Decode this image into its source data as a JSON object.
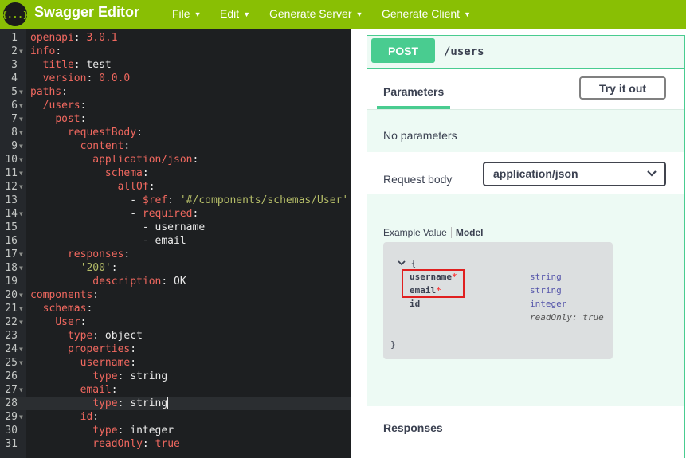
{
  "app": {
    "logo_glyph": "{...}",
    "title": "Swagger Editor",
    "brand_color": "#89bf04"
  },
  "menu": [
    {
      "label": "File"
    },
    {
      "label": "Edit"
    },
    {
      "label": "Generate Server"
    },
    {
      "label": "Generate Client"
    }
  ],
  "editor": {
    "active_line": 28,
    "lines": [
      {
        "n": "1",
        "tokens": [
          {
            "t": "openapi",
            "c": "key"
          },
          {
            "t": ": ",
            "c": "punc"
          },
          {
            "t": "3.0.1",
            "c": "num"
          }
        ]
      },
      {
        "n": "2",
        "fold": true,
        "tokens": [
          {
            "t": "info",
            "c": "key"
          },
          {
            "t": ":",
            "c": "punc"
          }
        ]
      },
      {
        "n": "3",
        "tokens": [
          {
            "t": "  ",
            "c": "txt"
          },
          {
            "t": "title",
            "c": "key"
          },
          {
            "t": ": test",
            "c": "txt"
          }
        ]
      },
      {
        "n": "4",
        "tokens": [
          {
            "t": "  ",
            "c": "txt"
          },
          {
            "t": "version",
            "c": "key"
          },
          {
            "t": ": ",
            "c": "punc"
          },
          {
            "t": "0.0.0",
            "c": "num"
          }
        ]
      },
      {
        "n": "5",
        "fold": true,
        "tokens": [
          {
            "t": "paths",
            "c": "key"
          },
          {
            "t": ":",
            "c": "punc"
          }
        ]
      },
      {
        "n": "6",
        "fold": true,
        "tokens": [
          {
            "t": "  ",
            "c": "txt"
          },
          {
            "t": "/users",
            "c": "key"
          },
          {
            "t": ":",
            "c": "punc"
          }
        ]
      },
      {
        "n": "7",
        "fold": true,
        "tokens": [
          {
            "t": "    ",
            "c": "txt"
          },
          {
            "t": "post",
            "c": "key"
          },
          {
            "t": ":",
            "c": "punc"
          }
        ]
      },
      {
        "n": "8",
        "fold": true,
        "tokens": [
          {
            "t": "      ",
            "c": "txt"
          },
          {
            "t": "requestBody",
            "c": "key"
          },
          {
            "t": ":",
            "c": "punc"
          }
        ]
      },
      {
        "n": "9",
        "fold": true,
        "tokens": [
          {
            "t": "        ",
            "c": "txt"
          },
          {
            "t": "content",
            "c": "key"
          },
          {
            "t": ":",
            "c": "punc"
          }
        ]
      },
      {
        "n": "10",
        "fold": true,
        "tokens": [
          {
            "t": "          ",
            "c": "txt"
          },
          {
            "t": "application/json",
            "c": "key"
          },
          {
            "t": ":",
            "c": "punc"
          }
        ]
      },
      {
        "n": "11",
        "fold": true,
        "tokens": [
          {
            "t": "            ",
            "c": "txt"
          },
          {
            "t": "schema",
            "c": "key"
          },
          {
            "t": ":",
            "c": "punc"
          }
        ]
      },
      {
        "n": "12",
        "fold": true,
        "tokens": [
          {
            "t": "              ",
            "c": "txt"
          },
          {
            "t": "allOf",
            "c": "key"
          },
          {
            "t": ":",
            "c": "punc"
          }
        ]
      },
      {
        "n": "13",
        "tokens": [
          {
            "t": "                - ",
            "c": "txt"
          },
          {
            "t": "$ref",
            "c": "key"
          },
          {
            "t": ": ",
            "c": "punc"
          },
          {
            "t": "'#/components/schemas/User'",
            "c": "str"
          }
        ]
      },
      {
        "n": "14",
        "fold": true,
        "tokens": [
          {
            "t": "                - ",
            "c": "txt"
          },
          {
            "t": "required",
            "c": "key"
          },
          {
            "t": ":",
            "c": "punc"
          }
        ]
      },
      {
        "n": "15",
        "tokens": [
          {
            "t": "                  - username",
            "c": "txt"
          }
        ]
      },
      {
        "n": "16",
        "tokens": [
          {
            "t": "                  - email",
            "c": "txt"
          }
        ]
      },
      {
        "n": "17",
        "fold": true,
        "tokens": [
          {
            "t": "      ",
            "c": "txt"
          },
          {
            "t": "responses",
            "c": "key"
          },
          {
            "t": ":",
            "c": "punc"
          }
        ]
      },
      {
        "n": "18",
        "fold": true,
        "tokens": [
          {
            "t": "        ",
            "c": "txt"
          },
          {
            "t": "'200'",
            "c": "str"
          },
          {
            "t": ":",
            "c": "punc"
          }
        ]
      },
      {
        "n": "19",
        "tokens": [
          {
            "t": "          ",
            "c": "txt"
          },
          {
            "t": "description",
            "c": "key"
          },
          {
            "t": ": OK",
            "c": "txt"
          }
        ]
      },
      {
        "n": "20",
        "fold": true,
        "tokens": [
          {
            "t": "components",
            "c": "key"
          },
          {
            "t": ":",
            "c": "punc"
          }
        ]
      },
      {
        "n": "21",
        "fold": true,
        "tokens": [
          {
            "t": "  ",
            "c": "txt"
          },
          {
            "t": "schemas",
            "c": "key"
          },
          {
            "t": ":",
            "c": "punc"
          }
        ]
      },
      {
        "n": "22",
        "fold": true,
        "tokens": [
          {
            "t": "    ",
            "c": "txt"
          },
          {
            "t": "User",
            "c": "key"
          },
          {
            "t": ":",
            "c": "punc"
          }
        ]
      },
      {
        "n": "23",
        "tokens": [
          {
            "t": "      ",
            "c": "txt"
          },
          {
            "t": "type",
            "c": "key"
          },
          {
            "t": ": object",
            "c": "txt"
          }
        ]
      },
      {
        "n": "24",
        "fold": true,
        "tokens": [
          {
            "t": "      ",
            "c": "txt"
          },
          {
            "t": "properties",
            "c": "key"
          },
          {
            "t": ":",
            "c": "punc"
          }
        ]
      },
      {
        "n": "25",
        "fold": true,
        "tokens": [
          {
            "t": "        ",
            "c": "txt"
          },
          {
            "t": "username",
            "c": "key"
          },
          {
            "t": ":",
            "c": "punc"
          }
        ]
      },
      {
        "n": "26",
        "tokens": [
          {
            "t": "          ",
            "c": "txt"
          },
          {
            "t": "type",
            "c": "key"
          },
          {
            "t": ": string",
            "c": "txt"
          }
        ]
      },
      {
        "n": "27",
        "fold": true,
        "tokens": [
          {
            "t": "        ",
            "c": "txt"
          },
          {
            "t": "email",
            "c": "key"
          },
          {
            "t": ":",
            "c": "punc"
          }
        ]
      },
      {
        "n": "28",
        "cursor": true,
        "tokens": [
          {
            "t": "          ",
            "c": "txt"
          },
          {
            "t": "type",
            "c": "key"
          },
          {
            "t": ": string",
            "c": "txt"
          }
        ]
      },
      {
        "n": "29",
        "fold": true,
        "tokens": [
          {
            "t": "        ",
            "c": "txt"
          },
          {
            "t": "id",
            "c": "key"
          },
          {
            "t": ":",
            "c": "punc"
          }
        ]
      },
      {
        "n": "30",
        "tokens": [
          {
            "t": "          ",
            "c": "txt"
          },
          {
            "t": "type",
            "c": "key"
          },
          {
            "t": ": integer",
            "c": "txt"
          }
        ]
      },
      {
        "n": "31",
        "tokens": [
          {
            "t": "          ",
            "c": "txt"
          },
          {
            "t": "readOnly",
            "c": "key"
          },
          {
            "t": ": ",
            "c": "punc"
          },
          {
            "t": "true",
            "c": "num"
          }
        ]
      }
    ]
  },
  "operation": {
    "method": "POST",
    "path": "/users",
    "method_color": "#49cc90"
  },
  "parameters": {
    "tab_label": "Parameters",
    "try_button": "Try it out",
    "empty_text": "No parameters"
  },
  "request_body": {
    "label": "Request body",
    "content_type": "application/json",
    "example_tab": "Example Value",
    "model_tab": "Model"
  },
  "model": {
    "open_brace": "{",
    "close_brace": "}",
    "toggle_icon": "chevron-down",
    "properties": [
      {
        "name": "username",
        "required": "*",
        "type": "string"
      },
      {
        "name": "email",
        "required": "*",
        "type": "string"
      },
      {
        "name": "id",
        "required": "",
        "type": "integer",
        "extra": "readOnly: true"
      }
    ]
  },
  "responses": {
    "label": "Responses"
  }
}
